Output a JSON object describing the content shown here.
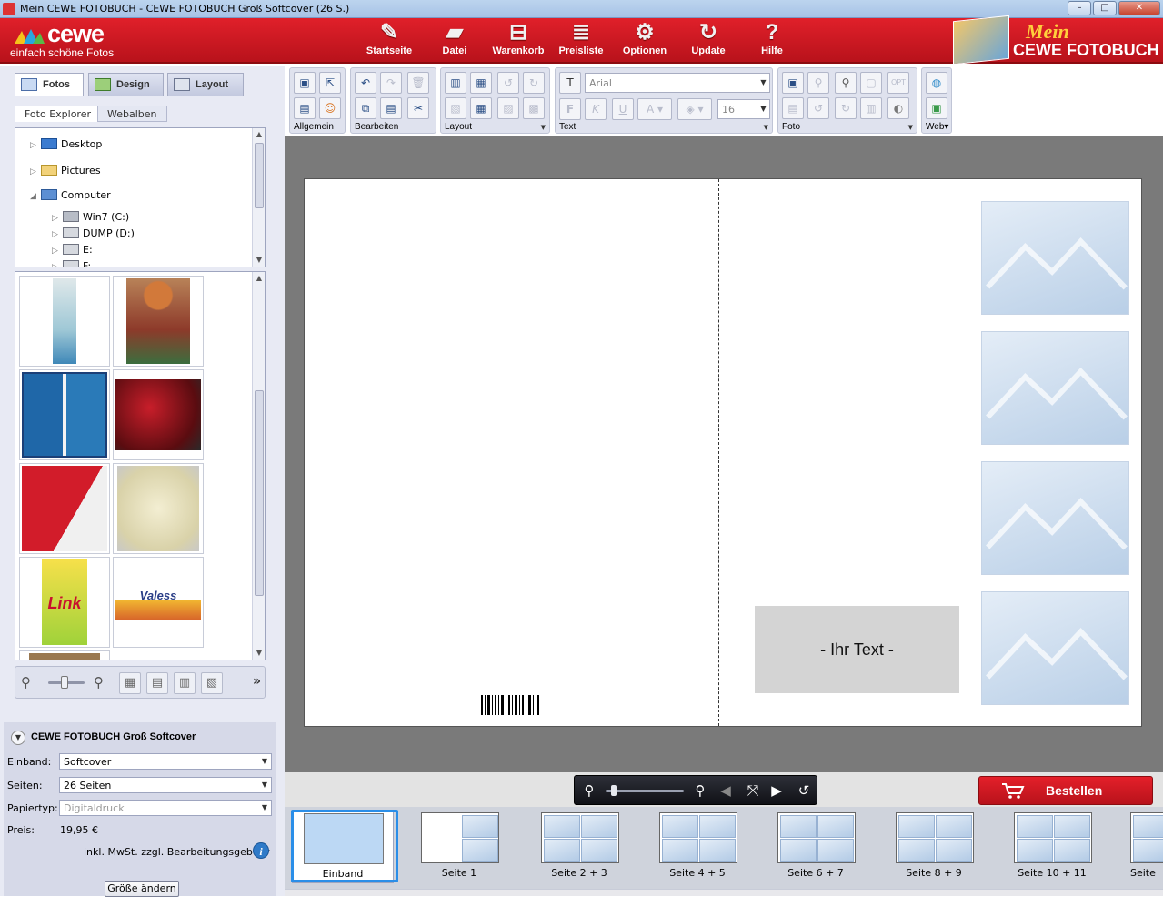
{
  "window": {
    "title": "Mein CEWE FOTOBUCH - CEWE FOTOBUCH Groß Softcover (26 S.)",
    "controls": [
      "–",
      "□",
      "✕"
    ]
  },
  "brand": {
    "logo": "cewe",
    "tagline": "einfach schöne Fotos",
    "product_line1": "Mein",
    "product_line2": "CEWE FOTOBUCH",
    "primary_color": "#cc1a22"
  },
  "nav": [
    {
      "label": "Startseite",
      "icon": "pencil-icon"
    },
    {
      "label": "Datei",
      "icon": "folder-icon"
    },
    {
      "label": "Warenkorb",
      "icon": "cart-icon"
    },
    {
      "label": "Preisliste",
      "icon": "pricelist-icon"
    },
    {
      "label": "Optionen",
      "icon": "gears-icon"
    },
    {
      "label": "Update",
      "icon": "refresh-icon"
    },
    {
      "label": "Hilfe",
      "icon": "question-icon"
    }
  ],
  "left_tabs": [
    {
      "label": "Fotos",
      "active": true
    },
    {
      "label": "Design",
      "active": false
    },
    {
      "label": "Layout",
      "active": false
    }
  ],
  "sub_tabs": [
    {
      "label": "Foto Explorer",
      "active": true
    },
    {
      "label": "Webalben",
      "active": false
    }
  ],
  "tree": [
    {
      "label": "Desktop",
      "level": 0
    },
    {
      "label": "Pictures",
      "level": 0
    },
    {
      "label": "Computer",
      "level": 0
    },
    {
      "label": "Win7 (C:)",
      "level": 1
    },
    {
      "label": "DUMP (D:)",
      "level": 1
    },
    {
      "label": "E:",
      "level": 1
    },
    {
      "label": "F:",
      "level": 1
    }
  ],
  "thumb_texts": {
    "link": "Link",
    "valess": "Valess"
  },
  "toolbar": {
    "groups": [
      "Allgemein",
      "Bearbeiten",
      "Layout",
      "Text",
      "Foto",
      "Web"
    ],
    "font_name": "Arial",
    "font_size": "16",
    "text_buttons": [
      "F",
      "K",
      "U"
    ],
    "web_label_suffix": "▾"
  },
  "book": {
    "title": "CEWE FOTOBUCH Groß Softcover",
    "binding_label": "Einband:",
    "binding_value": "Softcover",
    "pages_label": "Seiten:",
    "pages_value": "26 Seiten",
    "paper_label": "Papiertyp:",
    "paper_value": "Digitaldruck",
    "price_label": "Preis:",
    "price_value": "19,95 €",
    "tax_note": "inkl. MwSt. zzgl. Bearbeitungsgebühr",
    "resize_button": "Größe ändern"
  },
  "canvas": {
    "text_placeholder": "- Ihr Text -"
  },
  "order_button": "Bestellen",
  "pages": [
    {
      "label": "Einband",
      "selected": true
    },
    {
      "label": "Seite 1",
      "selected": false
    },
    {
      "label": "Seite 2 + 3",
      "selected": false
    },
    {
      "label": "Seite 4 + 5",
      "selected": false
    },
    {
      "label": "Seite 6 + 7",
      "selected": false
    },
    {
      "label": "Seite 8 + 9",
      "selected": false
    },
    {
      "label": "Seite 10 + 11",
      "selected": false
    },
    {
      "label": "Seite",
      "selected": false
    }
  ]
}
